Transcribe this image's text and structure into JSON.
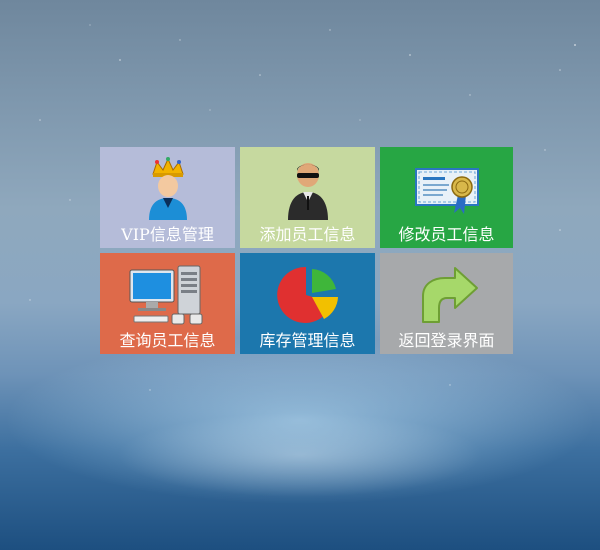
{
  "menu": {
    "tiles": [
      {
        "label": "VIP信息管理",
        "color": "#b5bcd9",
        "icon": "vip-crown-user-icon"
      },
      {
        "label": "添加员工信息",
        "color": "#c6d99f",
        "icon": "employee-add-icon"
      },
      {
        "label": "修改员工信息",
        "color": "#27a644",
        "icon": "certificate-edit-icon"
      },
      {
        "label": "查询员工信息",
        "color": "#de6a4a",
        "icon": "computer-server-query-icon"
      },
      {
        "label": "库存管理信息",
        "color": "#1c77ad",
        "icon": "pie-chart-icon"
      },
      {
        "label": "返回登录界面",
        "color": "#a7a9ab",
        "icon": "return-arrow-icon"
      }
    ]
  }
}
